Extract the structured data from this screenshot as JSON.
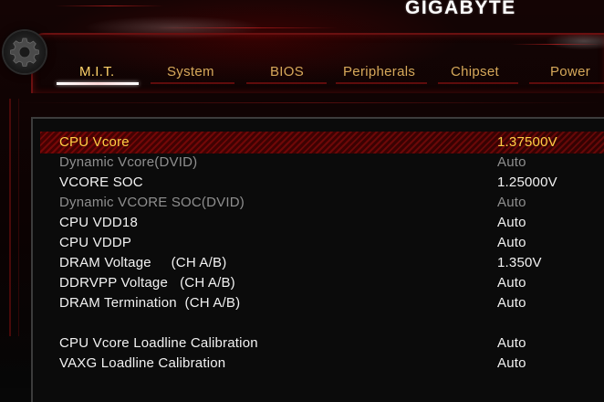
{
  "brand": "GIGABYTE",
  "tabs": [
    {
      "label": "M.I.T.",
      "active": true
    },
    {
      "label": "System",
      "active": false
    },
    {
      "label": "BIOS",
      "active": false
    },
    {
      "label": "Peripherals",
      "active": false
    },
    {
      "label": "Chipset",
      "active": false
    },
    {
      "label": "Power",
      "active": false
    }
  ],
  "settings": [
    {
      "label": "CPU Vcore",
      "value": "1.37500V",
      "state": "selected"
    },
    {
      "label": "Dynamic Vcore(DVID)",
      "value": "Auto",
      "state": "dim"
    },
    {
      "label": "VCORE SOC",
      "value": "1.25000V",
      "state": "normal"
    },
    {
      "label": "Dynamic VCORE SOC(DVID)",
      "value": "Auto",
      "state": "dim"
    },
    {
      "label": "CPU VDD18",
      "value": "Auto",
      "state": "normal"
    },
    {
      "label": "CPU VDDP",
      "value": "Auto",
      "state": "normal"
    },
    {
      "label": "DRAM Voltage     (CH A/B)",
      "value": "1.350V",
      "state": "normal"
    },
    {
      "label": "DDRVPP Voltage   (CH A/B)",
      "value": "Auto",
      "state": "normal"
    },
    {
      "label": "DRAM Termination  (CH A/B)",
      "value": "Auto",
      "state": "normal"
    },
    {
      "label": "CPU Vcore Loadline Calibration",
      "value": "Auto",
      "state": "normal"
    },
    {
      "label": "VAXG Loadline Calibration",
      "value": "Auto",
      "state": "normal"
    }
  ],
  "colors": {
    "accent_selected": "#ffcf45",
    "tab_text": "#d6a85a",
    "dim_text": "#8f8f8f",
    "highlight_red": "#8a0a0a"
  },
  "icons": {
    "settings_gear": "gear-icon"
  }
}
